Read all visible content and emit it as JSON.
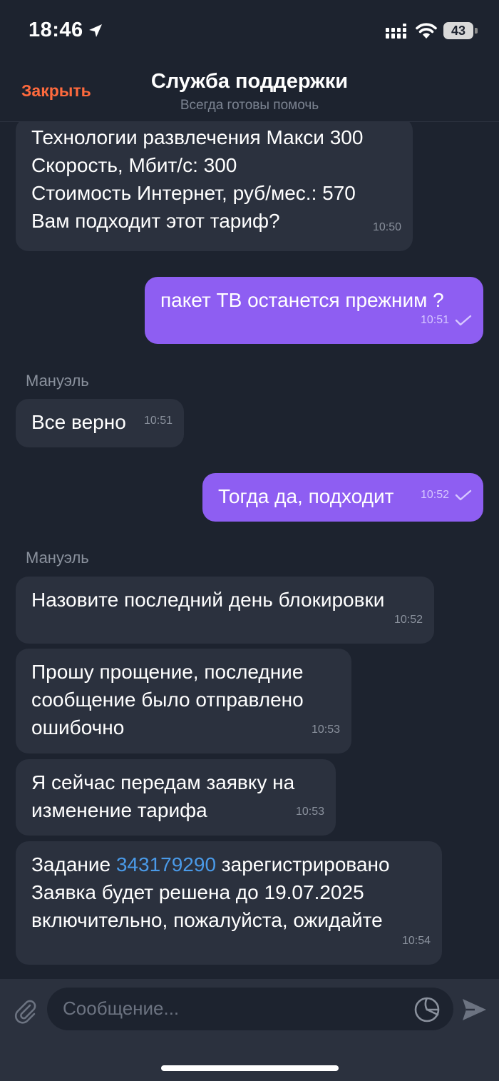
{
  "status_bar": {
    "time": "18:46",
    "battery": "43"
  },
  "header": {
    "close_label": "Закрыть",
    "title": "Служба поддержки",
    "subtitle": "Всегда готовы помочь"
  },
  "messages": [
    {
      "direction": "in",
      "text": "Технологии развлечения Макси 300\nСкорость, Мбит/с: 300\nСтоимость Интернет, руб/мес.: 570\nВам подходит этот тариф?",
      "time": "10:50"
    },
    {
      "direction": "out",
      "text": "пакет ТВ останется прежним ?",
      "time": "10:51",
      "status": "sent"
    },
    {
      "direction": "in",
      "sender": "Мануэль",
      "text": "Все верно",
      "time": "10:51"
    },
    {
      "direction": "out",
      "text": "Тогда да, подходит",
      "time": "10:52",
      "status": "sent"
    },
    {
      "direction": "in",
      "sender": "Мануэль",
      "text": "Назовите последний день блокировки",
      "time": "10:52"
    },
    {
      "direction": "in",
      "text": "Прошу прощение, последние\nсообщение было отправлено\nошибочно",
      "time": "10:53"
    },
    {
      "direction": "in",
      "text": "Я сейчас передам заявку на\nизменение тарифа",
      "time": "10:53"
    },
    {
      "direction": "in",
      "text_prefix": "Задание ",
      "link": "343179290",
      "text_suffix": " зарегистрировано\nЗаявка будет решена до 19.07.2025\nвключительно, пожалуйста, ожидайте",
      "time": "10:54"
    }
  ],
  "input": {
    "placeholder": "Сообщение..."
  },
  "colors": {
    "background": "#1d232f",
    "incoming_bubble": "#2b313e",
    "outgoing_bubble": "#8e5ef2",
    "accent": "#ff6a3d",
    "link": "#4a9ae8"
  },
  "icons": [
    "location-arrow-icon",
    "signal-icon",
    "wifi-icon",
    "battery-icon",
    "check-icon",
    "attach-icon",
    "sticker-icon",
    "send-icon"
  ]
}
